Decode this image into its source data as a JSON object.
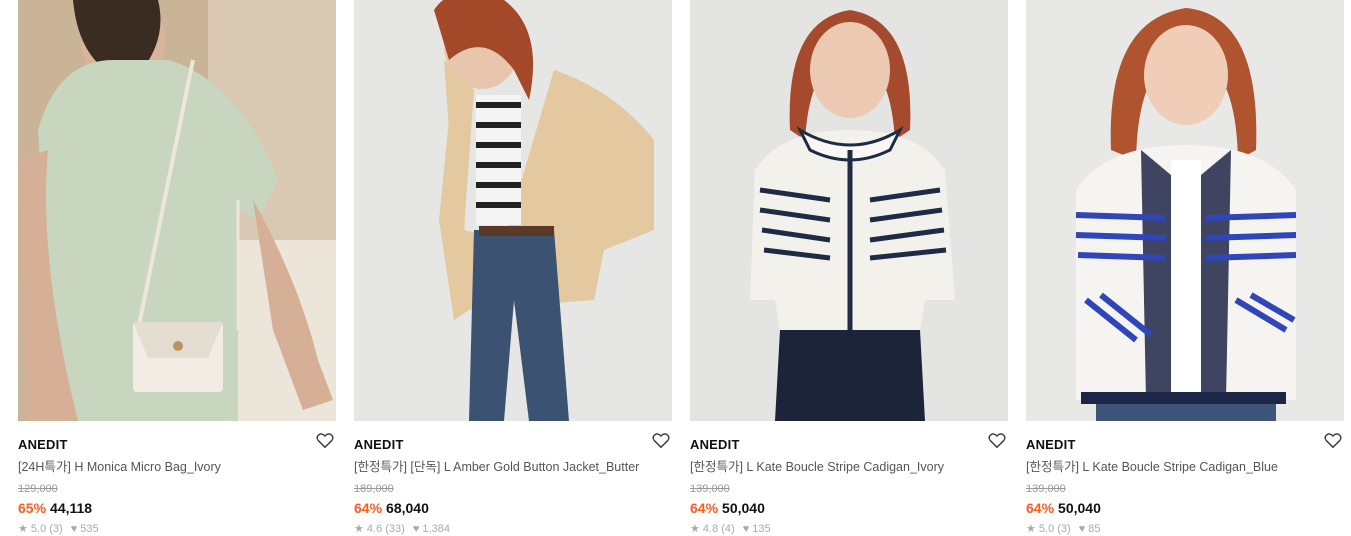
{
  "products": [
    {
      "brand": "ANEDIT",
      "name": "[24H특가] H Monica Micro Bag_Ivory",
      "original_price": "129,000",
      "discount": "65%",
      "price": "44,118",
      "rating": "★ 5.0 (3)",
      "likes": "♥ 535",
      "wish_icon": "heart-outline-icon"
    },
    {
      "brand": "ANEDIT",
      "name": "[한정특가] [단독] L Amber Gold Button Jacket_Butter",
      "original_price": "189,000",
      "discount": "64%",
      "price": "68,040",
      "rating": "★ 4.6 (33)",
      "likes": "♥ 1,384",
      "wish_icon": "heart-outline-icon"
    },
    {
      "brand": "ANEDIT",
      "name": "[한정특가] L Kate Boucle Stripe Cadigan_Ivory",
      "original_price": "139,000",
      "discount": "64%",
      "price": "50,040",
      "rating": "★ 4.8 (4)",
      "likes": "♥ 135",
      "wish_icon": "heart-outline-icon"
    },
    {
      "brand": "ANEDIT",
      "name": "[한정특가] L Kate Boucle Stripe Cadigan_Blue",
      "original_price": "139,000",
      "discount": "64%",
      "price": "50,040",
      "rating": "★ 5.0 (3)",
      "likes": "♥ 85",
      "wish_icon": "heart-outline-icon"
    }
  ],
  "colors": {
    "discount": "#ff5a1f",
    "text": "#111111",
    "muted": "#999999"
  }
}
